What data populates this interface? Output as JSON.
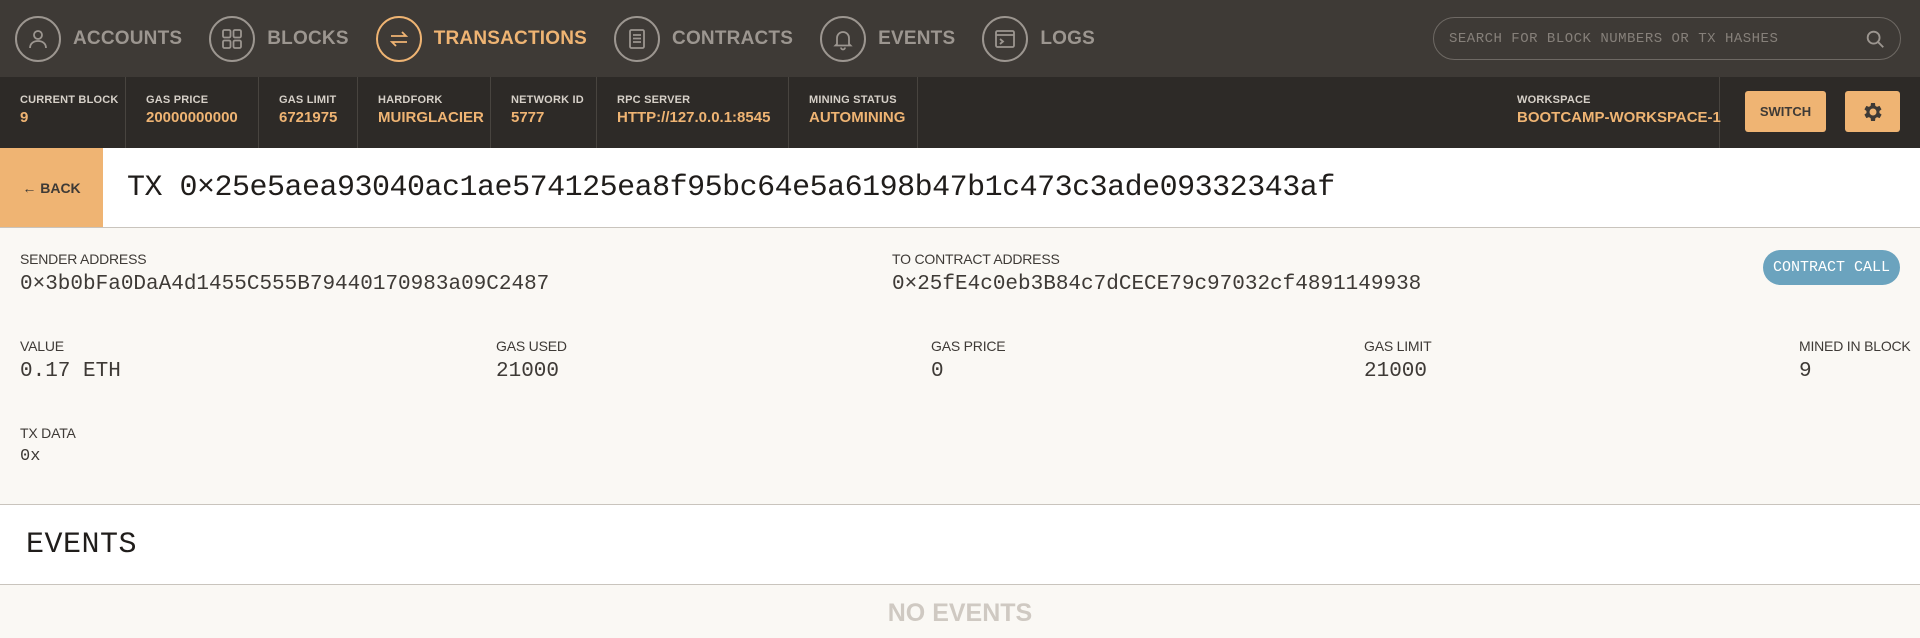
{
  "nav": {
    "items": [
      {
        "label": "ACCOUNTS",
        "icon": "user-icon"
      },
      {
        "label": "BLOCKS",
        "icon": "grid-icon"
      },
      {
        "label": "TRANSACTIONS",
        "icon": "swap-arrows-icon"
      },
      {
        "label": "CONTRACTS",
        "icon": "document-icon"
      },
      {
        "label": "EVENTS",
        "icon": "bell-icon"
      },
      {
        "label": "LOGS",
        "icon": "terminal-icon"
      }
    ],
    "active": "TRANSACTIONS",
    "search_placeholder": "SEARCH FOR BLOCK NUMBERS OR TX HASHES"
  },
  "status": {
    "current_block": {
      "label": "CURRENT BLOCK",
      "value": "9"
    },
    "gas_price": {
      "label": "GAS PRICE",
      "value": "20000000000"
    },
    "gas_limit": {
      "label": "GAS LIMIT",
      "value": "6721975"
    },
    "hardfork": {
      "label": "HARDFORK",
      "value": "MUIRGLACIER"
    },
    "network_id": {
      "label": "NETWORK ID",
      "value": "5777"
    },
    "rpc_server": {
      "label": "RPC SERVER",
      "value": "HTTP://127.0.0.1:8545"
    },
    "mining_status": {
      "label": "MINING STATUS",
      "value": "AUTOMINING"
    },
    "workspace": {
      "label": "WORKSPACE",
      "value": "BOOTCAMP-WORKSPACE-1"
    },
    "switch_label": "SWITCH"
  },
  "tx": {
    "back_label": "← BACK",
    "title": "TX 0×25e5aea93040ac1ae574125ea8f95bc64e5a6198b47b1c473c3ade09332343af",
    "sender": {
      "label": "SENDER ADDRESS",
      "value": "0×3b0bFa0DaA4d1455C555B79440170983a09C2487"
    },
    "to": {
      "label": "TO CONTRACT ADDRESS",
      "value": "0×25fE4c0eb3B84c7dCECE79c97032cf4891149938"
    },
    "type_badge": "CONTRACT CALL",
    "value": {
      "label": "VALUE",
      "value": "0.17 ETH"
    },
    "gas_used": {
      "label": "GAS USED",
      "value": "21000"
    },
    "gas_price": {
      "label": "GAS PRICE",
      "value": "0"
    },
    "gas_limit": {
      "label": "GAS LIMIT",
      "value": "21000"
    },
    "mined_in_block": {
      "label": "MINED IN BLOCK",
      "value": "9"
    },
    "tx_data": {
      "label": "TX DATA",
      "value": "0x"
    }
  },
  "events": {
    "title": "EVENTS",
    "empty_text": "NO EVENTS"
  },
  "colors": {
    "accent": "#efb473",
    "nav_bg": "#3e3a36",
    "status_bg": "#2d2a27",
    "badge": "#6ba3be"
  }
}
